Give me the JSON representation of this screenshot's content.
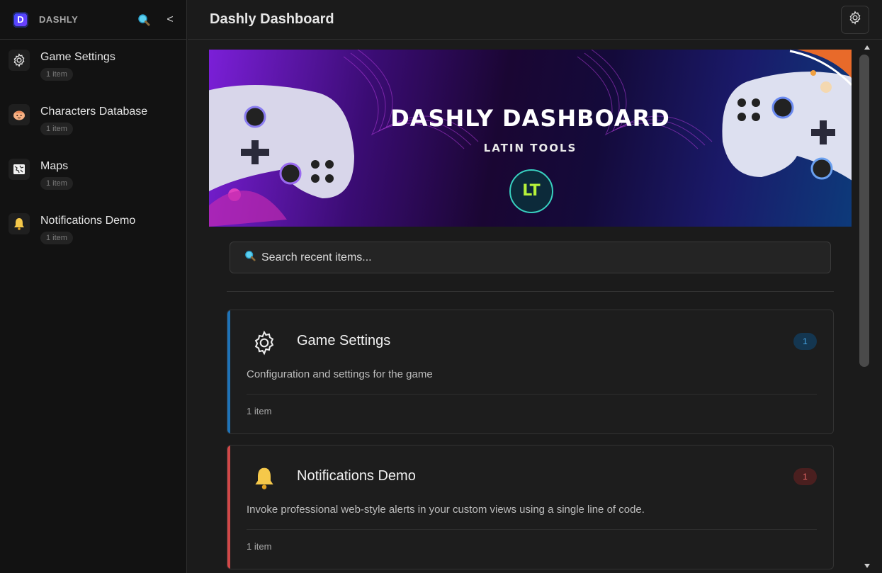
{
  "app": {
    "brand": "DASHLY",
    "logo_letter": "D",
    "page_title": "Dashly Dashboard"
  },
  "sidebar": {
    "items": [
      {
        "label": "Game Settings",
        "count": "1 item",
        "icon": "gear-icon"
      },
      {
        "label": "Characters Database",
        "count": "1 item",
        "icon": "smiley-face-icon"
      },
      {
        "label": "Maps",
        "count": "1 item",
        "icon": "map-icon"
      },
      {
        "label": "Notifications Demo",
        "count": "1 item",
        "icon": "bell-icon"
      }
    ],
    "collapse_label": "<"
  },
  "banner": {
    "title": "DASHLY DASHBOARD",
    "subtitle": "LATIN TOOLS",
    "logo_text": "LT"
  },
  "search": {
    "placeholder": "Search recent items..."
  },
  "cards": [
    {
      "title": "Game Settings",
      "badge": "1",
      "description": "Configuration and settings for the game",
      "footer": "1 item",
      "accent": "#1e73b8",
      "badge_bg": "#143650",
      "badge_fg": "#48a7e6",
      "icon": "gear-icon"
    },
    {
      "title": "Notifications Demo",
      "badge": "1",
      "description": "Invoke professional web-style alerts in your custom views using a single line of code.",
      "footer": "1 item",
      "accent": "#d24848",
      "badge_bg": "#4a1f1f",
      "badge_fg": "#ef6a6a",
      "icon": "bell-icon"
    }
  ]
}
